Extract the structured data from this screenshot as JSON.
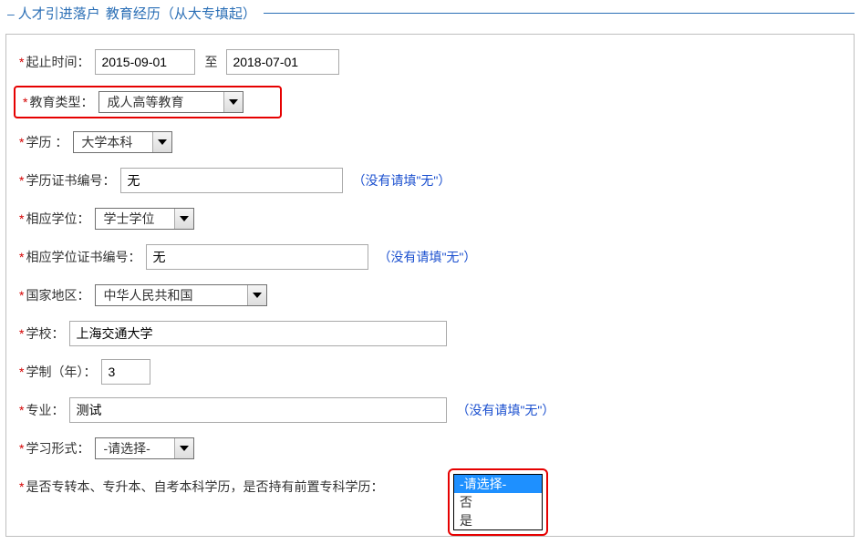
{
  "header": {
    "title": "人才引进落户",
    "sub": "教育经历（从大专填起）"
  },
  "labels": {
    "date_range": "起止时间：",
    "to": "至",
    "edu_type": "教育类型：",
    "degree_level": "学历 ：",
    "cert_no": "学历证书编号：",
    "degree": "相应学位：",
    "degree_cert_no": "相应学位证书编号：",
    "country": "国家地区：",
    "school": "学校：",
    "years": "学制（年）：",
    "major": "专业：",
    "study_mode": "学习形式：",
    "prior_qual": "是否专转本、专升本、自考本科学历，是否持有前置专科学历："
  },
  "values": {
    "start_date": "2015-09-01",
    "end_date": "2018-07-01",
    "edu_type": "成人高等教育",
    "degree_level": "大学本科",
    "cert_no": "无",
    "degree": "学士学位",
    "degree_cert_no": "无",
    "country": "中华人民共和国",
    "school": "上海交通大学",
    "years": "3",
    "major": "测试",
    "study_mode": "-请选择-"
  },
  "hints": {
    "no_fill_none": "（没有请填\"无\"）"
  },
  "dropdown": {
    "placeholder": "-请选择-",
    "opt_no": "否",
    "opt_yes": "是"
  }
}
